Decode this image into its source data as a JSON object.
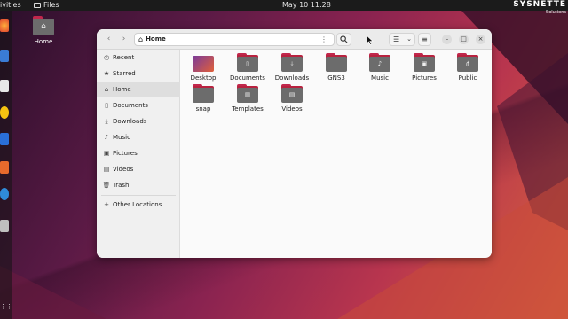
{
  "topbar": {
    "activities": "ivities",
    "app": "Files",
    "clock": "May 10  11:28"
  },
  "brand": {
    "name": "SYSNETTE",
    "tagline": "Solutions"
  },
  "desktop": {
    "home_label": "Home"
  },
  "window": {
    "path": "Home",
    "sidebar": [
      {
        "label": "Recent",
        "icon": "clock-icon"
      },
      {
        "label": "Starred",
        "icon": "star-icon"
      },
      {
        "label": "Home",
        "icon": "home-icon",
        "selected": true
      },
      {
        "label": "Documents",
        "icon": "document-icon"
      },
      {
        "label": "Downloads",
        "icon": "download-icon"
      },
      {
        "label": "Music",
        "icon": "music-icon"
      },
      {
        "label": "Pictures",
        "icon": "picture-icon"
      },
      {
        "label": "Videos",
        "icon": "video-icon"
      },
      {
        "label": "Trash",
        "icon": "trash-icon"
      },
      {
        "label": "Other Locations",
        "icon": "plus-icon"
      }
    ],
    "folders": [
      {
        "label": "Desktop",
        "icon": "desktop-folder-icon"
      },
      {
        "label": "Documents",
        "icon": "documents-folder-icon"
      },
      {
        "label": "Downloads",
        "icon": "downloads-folder-icon"
      },
      {
        "label": "GNS3",
        "icon": "folder-icon"
      },
      {
        "label": "Music",
        "icon": "music-folder-icon"
      },
      {
        "label": "Pictures",
        "icon": "pictures-folder-icon"
      },
      {
        "label": "Public",
        "icon": "public-folder-icon"
      },
      {
        "label": "snap",
        "icon": "folder-icon"
      },
      {
        "label": "Templates",
        "icon": "templates-folder-icon"
      },
      {
        "label": "Videos",
        "icon": "videos-folder-icon"
      }
    ]
  },
  "colors": {
    "accent": "#c2274c",
    "folder": "#6c6c6c"
  }
}
